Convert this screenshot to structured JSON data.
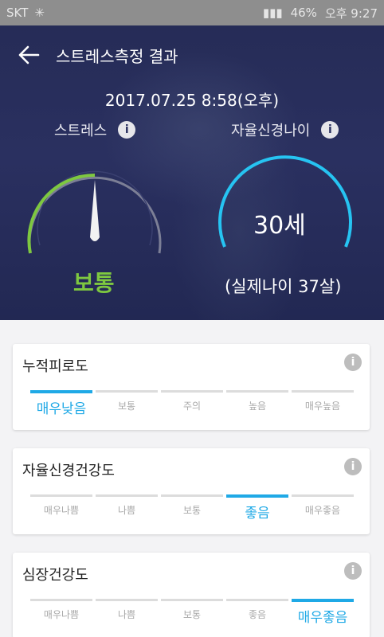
{
  "status_bar": {
    "carrier": "SKT",
    "battery": "46%",
    "time": "오후 9:27"
  },
  "header": {
    "title": "스트레스측정 결과",
    "back_icon": "arrow-left-icon"
  },
  "measurement": {
    "datetime": "2017.07.25 8:58(오후)"
  },
  "stress": {
    "label": "스트레스",
    "level_text": "보통",
    "level_color": "#7ec840"
  },
  "nerve_age": {
    "label": "자율신경나이",
    "value": "30세",
    "real_age": "(실제나이 37살)",
    "gauge_color": "#26c4f2"
  },
  "accent_color": "#1fa9e6",
  "cards": [
    {
      "title": "누적피로도",
      "levels": [
        "매우낮음",
        "보통",
        "주의",
        "높음",
        "매우높음"
      ],
      "active_index": 0
    },
    {
      "title": "자율신경건강도",
      "levels": [
        "매우나쁨",
        "나쁨",
        "보통",
        "좋음",
        "매우좋음"
      ],
      "active_index": 3
    },
    {
      "title": "심장건강도",
      "levels": [
        "매우나쁨",
        "나쁨",
        "보통",
        "좋음",
        "매우좋음"
      ],
      "active_index": 4
    }
  ]
}
